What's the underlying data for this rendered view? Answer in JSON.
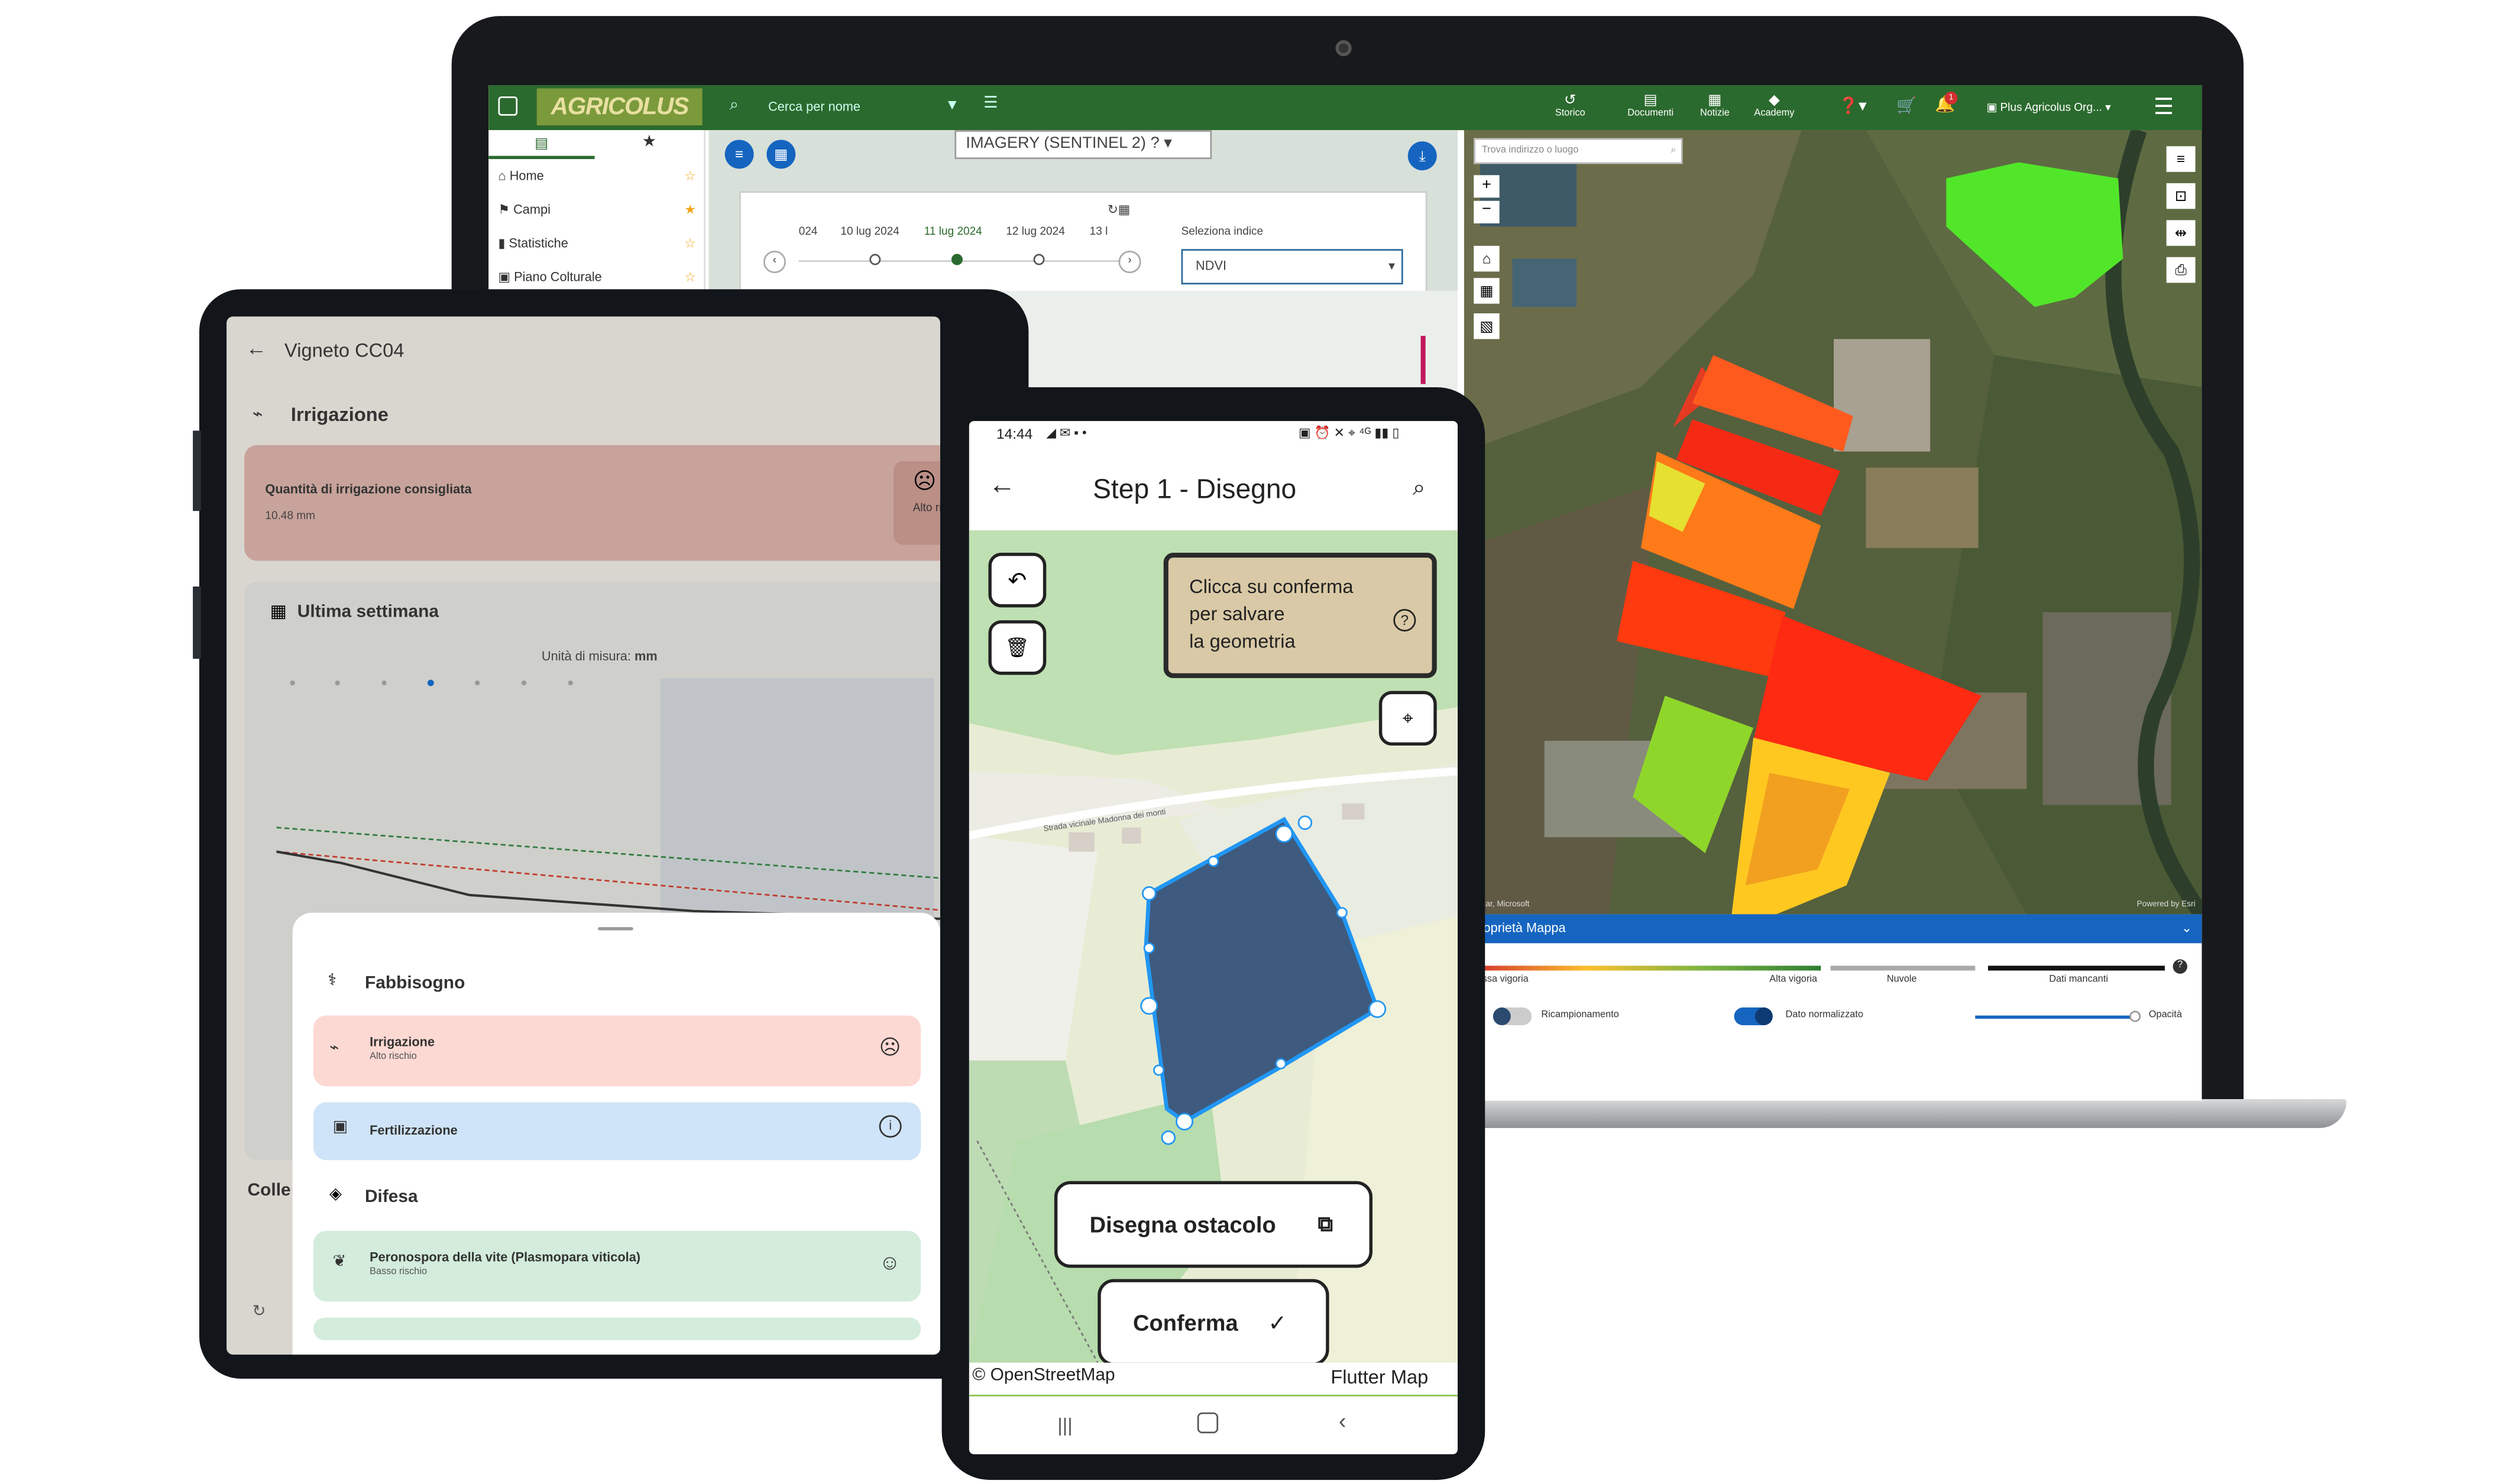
{
  "laptop": {
    "logo": "AGRICOLUS",
    "search_placeholder": "Cerca per nome",
    "nav": [
      {
        "icon": "history-icon",
        "label": "Storico"
      },
      {
        "icon": "documents-icon",
        "label": "Documenti"
      },
      {
        "icon": "news-icon",
        "label": "Notizie"
      },
      {
        "icon": "academy-icon",
        "label": "Academy"
      }
    ],
    "notification_count": "1",
    "org": "Plus Agricolus Org...",
    "sidebar": [
      {
        "label": "Home",
        "icon": "home-icon"
      },
      {
        "label": "Campi",
        "icon": "fields-icon"
      },
      {
        "label": "Statistiche",
        "icon": "stats-icon"
      },
      {
        "label": "Piano Colturale",
        "icon": "plan-icon"
      }
    ],
    "imagery_title": "IMAGERY (SENTINEL 2)",
    "dates": [
      "024",
      "10 lug 2024",
      "11 lug 2024",
      "12 lug 2024",
      "13 l"
    ],
    "selected_date": "11 lug 2024",
    "index_label": "Seleziona indice",
    "index_value": "NDVI",
    "address_placeholder": "Trova indirizzo o luogo",
    "attrib_left": "Maxar, Microsoft",
    "attrib_right": "Powered by Esri",
    "props_title": "Proprietà Mappa",
    "legend": {
      "low": "Bassa vigoria",
      "high": "Alta vigoria",
      "clouds": "Nuvole",
      "missing": "Dati mancanti"
    },
    "toggles": {
      "resample": "Ricampionamento",
      "normalized": "Dato normalizzato",
      "opacity": "Opacità"
    }
  },
  "tablet": {
    "back_title": "Vigneto CC04",
    "section": "Irrigazione",
    "irr_card_title": "Quantità di irrigazione consigliata",
    "irr_card_value": "10.48 mm",
    "irr_risk": "Alto rischio",
    "week_title": "Ultima settimana",
    "unit_label": "Unità di misura:",
    "unit_value": "mm",
    "partial_label": "Colle",
    "sheet": {
      "need_title": "Fabbisogno",
      "items": [
        {
          "title": "Irrigazione",
          "sub": "Alto rischio",
          "color": "#fdd9d3",
          "icon": "sad-face-icon"
        },
        {
          "title": "Fertilizzazione",
          "sub": "",
          "color": "#cfe4f8",
          "icon": "info-icon"
        }
      ],
      "defense_title": "Difesa",
      "defense_items": [
        {
          "title": "Peronospora della vite (Plasmopara viticola)",
          "sub": "Basso rischio",
          "color": "#d3ecdc",
          "icon": "happy-face-icon"
        }
      ]
    }
  },
  "phone": {
    "time": "14:44",
    "title": "Step 1 - Disegno",
    "hint": [
      "Clicca su conferma",
      "per salvare",
      "la geometria"
    ],
    "road_label": "Strada vicinale Madonna dei monti",
    "btn_obstacle": "Disegna ostacolo",
    "btn_confirm": "Conferma",
    "attr_left": "© OpenStreetMap",
    "attr_right": "Flutter Map"
  }
}
